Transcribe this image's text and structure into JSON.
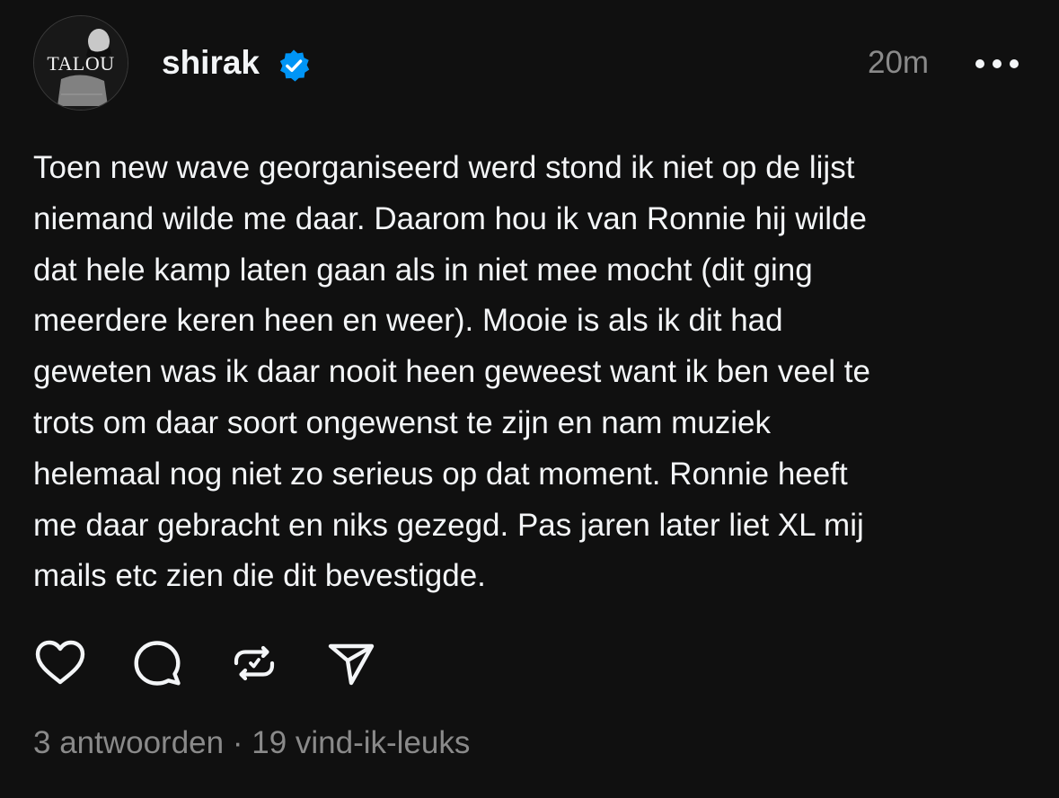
{
  "post": {
    "author": {
      "username": "shirak",
      "verified": true,
      "avatar_text": "TALOU"
    },
    "timestamp": "20m",
    "body_lines": [
      "Toen new wave georganiseerd werd stond ik niet op de lijst",
      "niemand wilde me daar. Daarom hou ik van Ronnie hij wilde",
      "dat hele kamp laten gaan als in niet mee mocht (dit ging",
      "meerdere keren heen en weer). Mooie is als ik dit had",
      "geweten was ik daar nooit heen geweest want ik ben veel te",
      "trots om daar soort ongewenst te zijn en nam muziek",
      "helemaal nog niet zo serieus op dat moment. Ronnie heeft",
      "me daar gebracht en niks gezegd. Pas jaren later liet XL mij",
      "mails etc zien die dit bevestigde."
    ],
    "actions": [
      {
        "name": "like",
        "icon": "heart-icon"
      },
      {
        "name": "reply",
        "icon": "comment-icon"
      },
      {
        "name": "repost",
        "icon": "repost-icon"
      },
      {
        "name": "share",
        "icon": "send-icon"
      }
    ],
    "stats": {
      "replies": "3 antwoorden",
      "separator": "·",
      "likes": "19 vind-ik-leuks"
    }
  },
  "colors": {
    "background": "#101010",
    "text_primary": "#f3f5f7",
    "text_secondary": "#8a8a8a",
    "verified_badge": "#0095f6"
  }
}
